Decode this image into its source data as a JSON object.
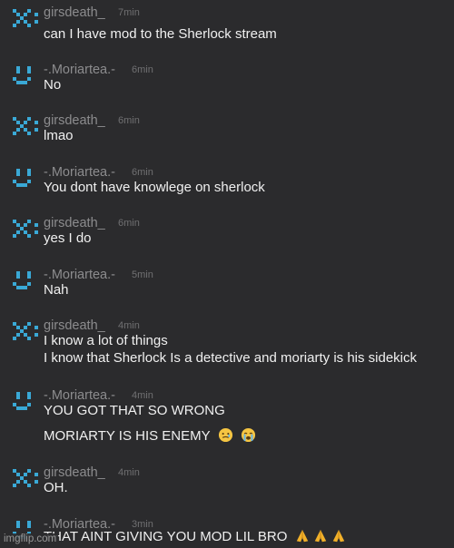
{
  "colors": {
    "background": "#2b2b2d",
    "avatar": "#3aa9d6",
    "username": "#8c8c8e",
    "time": "#707072",
    "text": "#f0f0f0"
  },
  "messages": [
    {
      "user": "girsdeath_",
      "time": "7min",
      "avatar": "x-pixel-avatar",
      "lines": [
        "can I have mod to the Sherlock stream"
      ]
    },
    {
      "user": "-.Moriartea.-",
      "time": "6min",
      "avatar": "smile-pixel-avatar",
      "lines": [
        "No"
      ]
    },
    {
      "user": "girsdeath_",
      "time": "6min",
      "avatar": "x-pixel-avatar",
      "lines": [
        "lmao"
      ]
    },
    {
      "user": "-.Moriartea.-",
      "time": "6min",
      "avatar": "smile-pixel-avatar",
      "lines": [
        "You dont have knowlege on sherlock"
      ]
    },
    {
      "user": "girsdeath_",
      "time": "6min",
      "avatar": "x-pixel-avatar",
      "lines": [
        "yes I do"
      ]
    },
    {
      "user": "-.Moriartea.-",
      "time": "5min",
      "avatar": "smile-pixel-avatar",
      "lines": [
        "Nah"
      ]
    },
    {
      "user": "girsdeath_",
      "time": "4min",
      "avatar": "x-pixel-avatar",
      "lines": [
        "I know a lot of things",
        "I know that Sherlock Is a detective and moriarty is his sidekick"
      ]
    },
    {
      "user": "-.Moriartea.-",
      "time": "4min",
      "avatar": "smile-pixel-avatar",
      "lines": [
        "YOU GOT THAT SO WRONG",
        "",
        "MORIARTY IS HIS ENEMY"
      ],
      "emoji": [
        "tearful-smile-emoji",
        "crying-emoji"
      ]
    },
    {
      "user": "girsdeath_",
      "time": "4min",
      "avatar": "x-pixel-avatar",
      "lines": [
        "OH."
      ]
    },
    {
      "user": "-.Moriartea.-",
      "time": "3min",
      "avatar": "smile-pixel-avatar",
      "lines": [
        "THAT AINT GIVING YOU MOD LIL BRO"
      ],
      "emoji": [
        "folded-hands-emoji",
        "folded-hands-emoji",
        "folded-hands-emoji"
      ]
    }
  ],
  "watermark": "imgflip.com"
}
